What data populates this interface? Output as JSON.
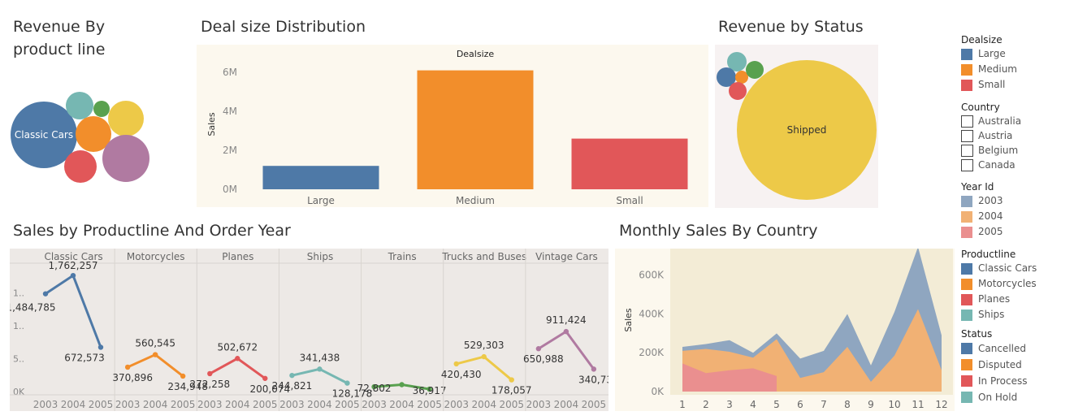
{
  "titles": {
    "bubble": "Revenue By product line",
    "dealsize": "Deal size Distribution",
    "status": "Revenue by Status",
    "productline_year": "Sales by Productline And Order Year",
    "monthly": "Monthly Sales By Country"
  },
  "colors": {
    "blue": "#4e79a7",
    "orange": "#f28e2b",
    "red": "#e15759",
    "teal": "#76b7b2",
    "green": "#59a14f",
    "yellow": "#edc948",
    "purple": "#b07aa1",
    "panel_bg": "#fcf8ee",
    "status_bg": "#f7f2f2",
    "grid_bg": "#ede9e6",
    "area_bg": "#f3ecd6"
  },
  "legend": {
    "dealsize": {
      "title": "Dealsize",
      "items": [
        {
          "label": "Large",
          "color": "#4e79a7"
        },
        {
          "label": "Medium",
          "color": "#f28e2b"
        },
        {
          "label": "Small",
          "color": "#e15759"
        }
      ]
    },
    "country": {
      "title": "Country",
      "items": [
        "Australia",
        "Austria",
        "Belgium",
        "Canada"
      ]
    },
    "year": {
      "title": "Year Id",
      "items": [
        {
          "label": "2003",
          "color": "#8fa6c0"
        },
        {
          "label": "2004",
          "color": "#f1b174"
        },
        {
          "label": "2005",
          "color": "#ea8f8f"
        }
      ]
    },
    "productline": {
      "title": "Productline",
      "items": [
        {
          "label": "Classic Cars",
          "color": "#4e79a7"
        },
        {
          "label": "Motorcycles",
          "color": "#f28e2b"
        },
        {
          "label": "Planes",
          "color": "#e15759"
        },
        {
          "label": "Ships",
          "color": "#76b7b2"
        }
      ]
    },
    "status": {
      "title": "Status",
      "items": [
        {
          "label": "Cancelled",
          "color": "#4e79a7"
        },
        {
          "label": "Disputed",
          "color": "#f28e2b"
        },
        {
          "label": "In Process",
          "color": "#e15759"
        },
        {
          "label": "On Hold",
          "color": "#76b7b2"
        }
      ]
    }
  },
  "chart_data": [
    {
      "id": "bubble",
      "type": "packed-bubble",
      "title": "Revenue By product line",
      "items": [
        {
          "label": "Classic Cars",
          "color": "#4e79a7",
          "show_label": true
        },
        {
          "label": "",
          "color": "#76b7b2"
        },
        {
          "label": "",
          "color": "#59a14f"
        },
        {
          "label": "",
          "color": "#edc948"
        },
        {
          "label": "",
          "color": "#f28e2b"
        },
        {
          "label": "",
          "color": "#b07aa1"
        },
        {
          "label": "",
          "color": "#e15759"
        }
      ]
    },
    {
      "id": "dealsize",
      "type": "bar",
      "title": "Deal size Distribution",
      "header": "Dealsize",
      "ylabel": "Sales",
      "categories": [
        "Large",
        "Medium",
        "Small"
      ],
      "values": [
        1.2,
        6.1,
        2.6
      ],
      "colors": [
        "#4e79a7",
        "#f28e2b",
        "#e15759"
      ],
      "ylim": [
        0,
        6.5
      ],
      "yticks": [
        {
          "v": 0,
          "label": "0M"
        },
        {
          "v": 2,
          "label": "2M"
        },
        {
          "v": 4,
          "label": "4M"
        },
        {
          "v": 6,
          "label": "6M"
        }
      ]
    },
    {
      "id": "status",
      "type": "packed-bubble",
      "title": "Revenue by Status",
      "items": [
        {
          "label": "Shipped",
          "color": "#edc948",
          "show_label": true
        },
        {
          "label": "",
          "color": "#76b7b2"
        },
        {
          "label": "",
          "color": "#4e79a7"
        },
        {
          "label": "",
          "color": "#f28e2b"
        },
        {
          "label": "",
          "color": "#59a14f"
        },
        {
          "label": "",
          "color": "#e15759"
        }
      ]
    },
    {
      "id": "productline_year",
      "type": "line",
      "title": "Sales by Productline And Order Year",
      "x": [
        "2003",
        "2004",
        "2005"
      ],
      "ylim": [
        0,
        1900000
      ],
      "yticks": [
        {
          "v": 0,
          "label": "0K"
        },
        {
          "v": 500000,
          "label": "5.."
        },
        {
          "v": 1000000,
          "label": "1.."
        },
        {
          "v": 1500000,
          "label": "1.."
        }
      ],
      "series": [
        {
          "name": "Classic Cars",
          "color": "#4e79a7",
          "values": [
            1484785,
            1762257,
            672573
          ],
          "labels": [
            "1,484,785",
            "1,762,257",
            "672,573"
          ]
        },
        {
          "name": "Motorcycles",
          "color": "#f28e2b",
          "values": [
            370896,
            560545,
            234948
          ],
          "labels": [
            "370,896",
            "560,545",
            "234,948"
          ]
        },
        {
          "name": "Planes",
          "color": "#e15759",
          "values": [
            272258,
            502672,
            200074
          ],
          "labels": [
            "272,258",
            "502,672",
            "200,074"
          ]
        },
        {
          "name": "Ships",
          "color": "#76b7b2",
          "values": [
            244821,
            341438,
            128178
          ],
          "labels": [
            "244,821",
            "341,438",
            "128,178"
          ]
        },
        {
          "name": "Trains",
          "color": "#59a14f",
          "values": [
            72802,
            105000,
            36917
          ],
          "labels": [
            "72,802",
            "",
            "36,917"
          ]
        },
        {
          "name": "Trucks and Buses",
          "color": "#edc948",
          "values": [
            420430,
            529303,
            178057
          ],
          "labels": [
            "420,430",
            "529,303",
            "178,057"
          ]
        },
        {
          "name": "Vintage Cars",
          "color": "#b07aa1",
          "values": [
            650988,
            911424,
            340739
          ],
          "labels": [
            "650,988",
            "911,424",
            "340,739"
          ]
        }
      ]
    },
    {
      "id": "monthly",
      "type": "area",
      "title": "Monthly Sales By Country",
      "ylabel": "Sales",
      "x": [
        "1",
        "2",
        "3",
        "4",
        "5",
        "6",
        "7",
        "8",
        "9",
        "10",
        "11",
        "12"
      ],
      "ylim": [
        0,
        720000
      ],
      "yticks": [
        {
          "v": 0,
          "label": "0K"
        },
        {
          "v": 200000,
          "label": "200K"
        },
        {
          "v": 400000,
          "label": "400K"
        },
        {
          "v": 600000,
          "label": "600K"
        }
      ],
      "series": [
        {
          "name": "2003",
          "color": "#8fa6c0",
          "values": [
            230000,
            245000,
            265000,
            200000,
            300000,
            170000,
            210000,
            400000,
            135000,
            410000,
            745000,
            290000
          ]
        },
        {
          "name": "2004",
          "color": "#f1b174",
          "values": [
            210000,
            220000,
            205000,
            175000,
            270000,
            70000,
            100000,
            230000,
            50000,
            185000,
            425000,
            110000
          ]
        },
        {
          "name": "2005",
          "color": "#ea8f8f",
          "values": [
            145000,
            95000,
            110000,
            120000,
            80000,
            null,
            null,
            null,
            null,
            null,
            null,
            null
          ]
        }
      ]
    }
  ]
}
